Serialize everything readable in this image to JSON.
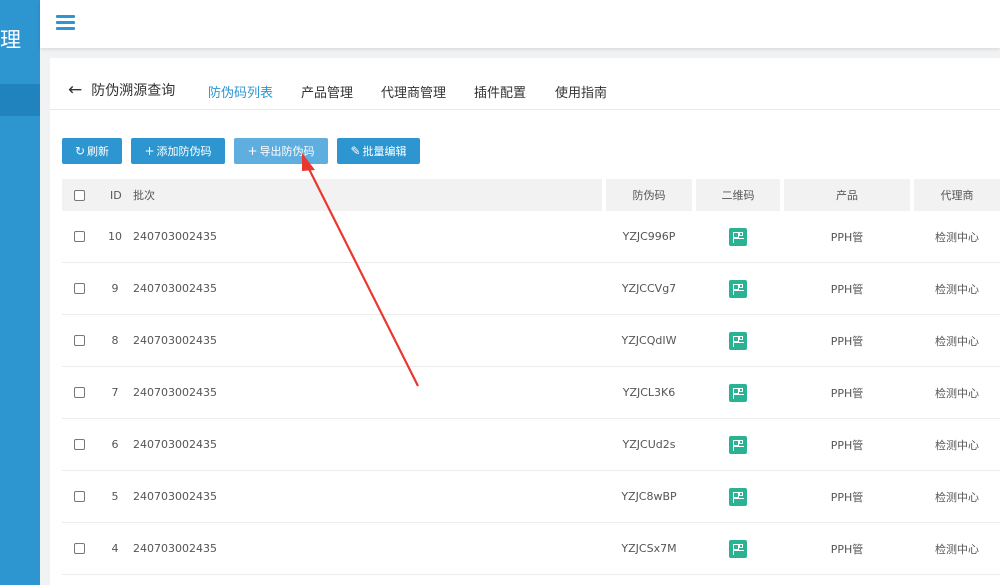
{
  "sidebar": {
    "title": "理"
  },
  "breadcrumb": {
    "back_label": "防伪溯源查询"
  },
  "tabs": [
    {
      "label": "防伪码列表",
      "active": true
    },
    {
      "label": "产品管理",
      "active": false
    },
    {
      "label": "代理商管理",
      "active": false
    },
    {
      "label": "插件配置",
      "active": false
    },
    {
      "label": "使用指南",
      "active": false
    }
  ],
  "toolbar": {
    "refresh_label": "刷新",
    "add_label": "添加防伪码",
    "export_label": "导出防伪码",
    "batch_edit_label": "批量编辑"
  },
  "table": {
    "columns": [
      "ID",
      "批次",
      "防伪码",
      "二维码",
      "产品",
      "代理商"
    ],
    "rows": [
      {
        "id": "10",
        "batch": "240703002435",
        "code": "YZJC996P",
        "product": "PPH管",
        "agent": "检测中心"
      },
      {
        "id": "9",
        "batch": "240703002435",
        "code": "YZJCCVg7",
        "product": "PPH管",
        "agent": "检测中心"
      },
      {
        "id": "8",
        "batch": "240703002435",
        "code": "YZJCQdIW",
        "product": "PPH管",
        "agent": "检测中心"
      },
      {
        "id": "7",
        "batch": "240703002435",
        "code": "YZJCL3K6",
        "product": "PPH管",
        "agent": "检测中心"
      },
      {
        "id": "6",
        "batch": "240703002435",
        "code": "YZJCUd2s",
        "product": "PPH管",
        "agent": "检测中心"
      },
      {
        "id": "5",
        "batch": "240703002435",
        "code": "YZJC8wBP",
        "product": "PPH管",
        "agent": "检测中心"
      },
      {
        "id": "4",
        "batch": "240703002435",
        "code": "YZJCSx7M",
        "product": "PPH管",
        "agent": "检测中心"
      }
    ]
  },
  "colors": {
    "primary": "#2d96d1",
    "qr": "#29b392",
    "annotation_arrow": "#e8382f"
  }
}
